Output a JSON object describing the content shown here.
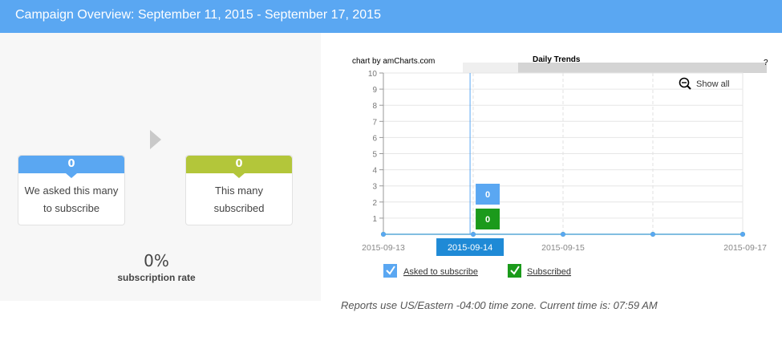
{
  "header": {
    "title": "Campaign Overview: September 11, 2015 - September 17, 2015"
  },
  "funnel": {
    "asked": {
      "count": "0",
      "label_line1": "We asked this many",
      "label_line2": "to subscribe"
    },
    "subscribed": {
      "count": "0",
      "label_line1": "This many",
      "label_line2": "subscribed"
    },
    "rate": {
      "value": "0%",
      "label": "subscription rate"
    }
  },
  "chart_widget": {
    "credit": "chart by amCharts.com",
    "title": "Daily Trends",
    "help": "?",
    "show_all": "Show all",
    "cursor_date": "2015-09-14",
    "balloons": {
      "asked": "0",
      "subscribed": "0"
    }
  },
  "chart_data": {
    "type": "line",
    "title": "Daily Trends",
    "x": [
      "2015-09-13",
      "2015-09-14",
      "2015-09-15",
      "2015-09-16",
      "2015-09-17"
    ],
    "x_tick_labels": [
      "2015-09-13",
      "2015-09-14",
      "2015-09-15",
      "2015-09-17"
    ],
    "ylim": [
      0,
      10
    ],
    "y_ticks": [
      1,
      2,
      3,
      4,
      5,
      6,
      7,
      8,
      9,
      10
    ],
    "grid": true,
    "legend": "bottom",
    "series": [
      {
        "name": "Asked to subscribe",
        "values": [
          0,
          0,
          0,
          0,
          0
        ],
        "color": "#5aa7f2"
      },
      {
        "name": "Subscribed",
        "values": [
          0,
          0,
          0,
          0,
          0
        ],
        "color": "#1b9a1b"
      }
    ]
  },
  "footer": {
    "text": "Reports use US/Eastern -04:00 time zone. Current time is: 07:59 AM"
  }
}
